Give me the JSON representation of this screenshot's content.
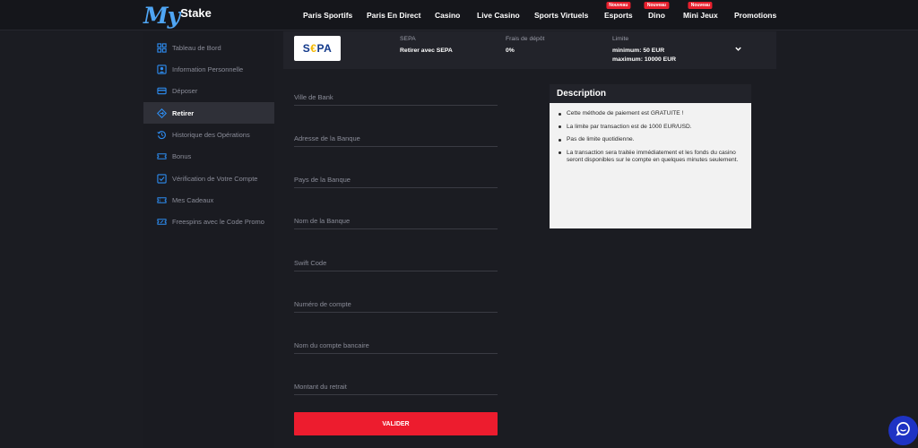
{
  "brand": {
    "logo_main": "My",
    "logo_sub": "Stake"
  },
  "nav": [
    {
      "label": "Paris Sportifs",
      "badge": ""
    },
    {
      "label": "Paris En Direct",
      "badge": ""
    },
    {
      "label": "Casino",
      "badge": ""
    },
    {
      "label": "Live Casino",
      "badge": ""
    },
    {
      "label": "Sports Virtuels",
      "badge": ""
    },
    {
      "label": "Esports",
      "badge": "Nouveau"
    },
    {
      "label": "Dino",
      "badge": "Nouveau"
    },
    {
      "label": "Mini Jeux",
      "badge": "Nouveau"
    },
    {
      "label": "Promotions",
      "badge": ""
    }
  ],
  "sidebar": {
    "active_index": 3,
    "items": [
      {
        "label": "Tableau de Bord",
        "icon": "dashboard-icon"
      },
      {
        "label": "Information Personnelle",
        "icon": "user-card-icon"
      },
      {
        "label": "Déposer",
        "icon": "card-icon"
      },
      {
        "label": "Retirer",
        "icon": "withdraw-icon"
      },
      {
        "label": "Historique des Opérations",
        "icon": "history-icon"
      },
      {
        "label": "Bonus",
        "icon": "ticket-icon"
      },
      {
        "label": "Vérification de Votre Compte",
        "icon": "check-square-icon"
      },
      {
        "label": "Mes Cadeaux",
        "icon": "gift-icon"
      },
      {
        "label": "Freespins avec le Code Promo",
        "icon": "promo-ticket-icon"
      }
    ]
  },
  "payment": {
    "logo_text_1": "S",
    "logo_text_e": "€",
    "logo_text_2": "PA",
    "method_label": "SEPA",
    "method_value": "Retirer avec SEPA",
    "fee_label": "Frais de dépôt",
    "fee_value": "0%",
    "limit_label": "Limite",
    "limit_min": "minimum: 50 EUR",
    "limit_max": "maximum: 10000 EUR"
  },
  "form": {
    "fields": [
      {
        "placeholder": "Ville de Bank",
        "value": ""
      },
      {
        "placeholder": "Adresse de la Banque",
        "value": ""
      },
      {
        "placeholder": "Pays de la Banque",
        "value": ""
      },
      {
        "placeholder": "Nom de la Banque",
        "value": ""
      },
      {
        "placeholder": "Swift Code",
        "value": ""
      },
      {
        "placeholder": "Numéro de compte",
        "value": ""
      },
      {
        "placeholder": "Nom du compte bancaire",
        "value": ""
      },
      {
        "placeholder": "Montant du retrait",
        "value": ""
      }
    ],
    "submit_label": "VALIDER"
  },
  "description": {
    "title": "Description",
    "items": [
      "Cette méthode de paiement est GRATUITE !",
      "La limite par transaction est de 1000 EUR/USD.",
      "Pas de limite quotidienne.",
      "La transaction sera traitée immédiatement et les fonds du casino seront disponibles sur le compte en quelques minutes seulement."
    ]
  },
  "colors": {
    "accent_blue": "#2d8cf0",
    "button_red": "#ed1c2e",
    "badge_red": "#e8202e",
    "chat_blue": "#1e33c4"
  },
  "chat": {
    "icon": "chat-icon"
  }
}
